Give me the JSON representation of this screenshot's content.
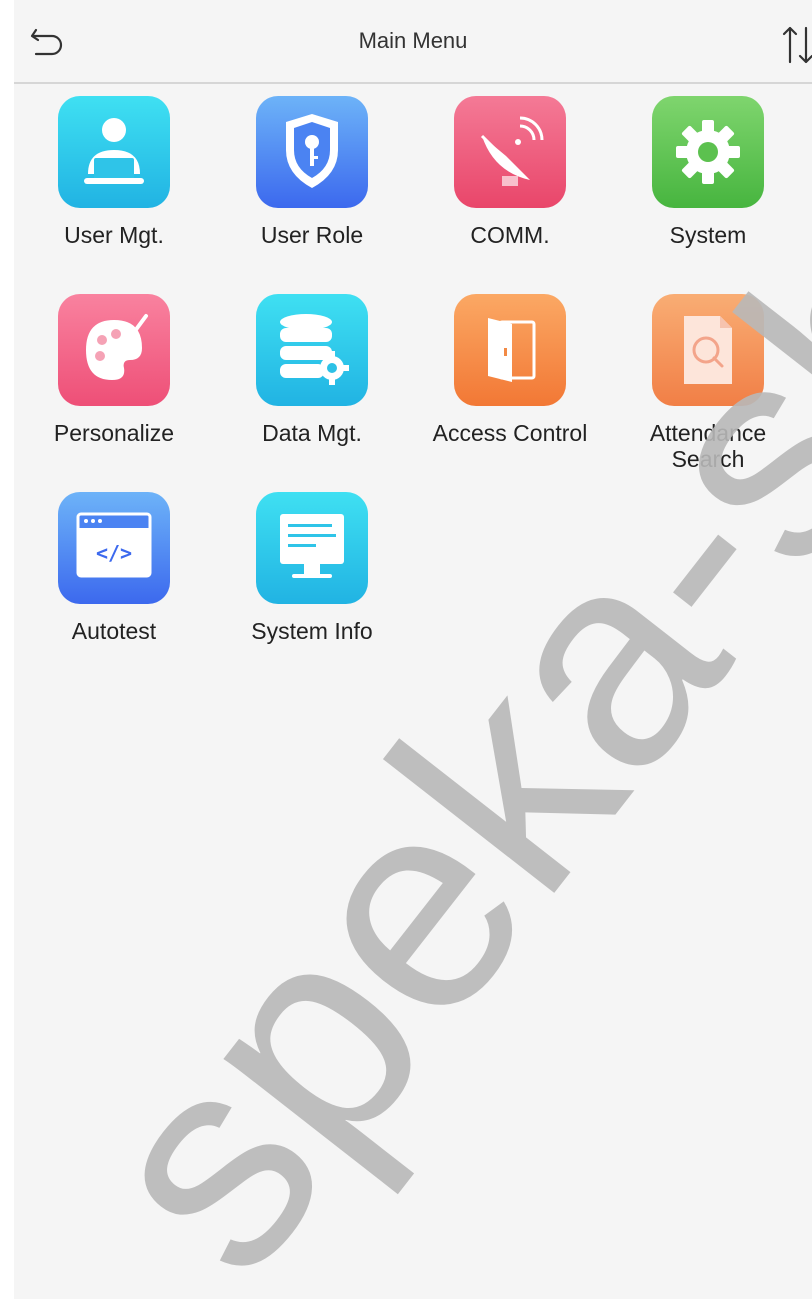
{
  "header": {
    "title": "Main Menu",
    "back_icon": "back-arrow-icon",
    "sort_icon": "sort-arrows-icon"
  },
  "menu": {
    "items": [
      {
        "label": "User Mgt.",
        "icon": "user-icon",
        "color_top": "#3fd6ef",
        "color_bottom": "#1fb6e0"
      },
      {
        "label": "User Role",
        "icon": "shield-key-icon",
        "color_top": "#6aa2f7",
        "color_bottom": "#3d6ef0"
      },
      {
        "label": "COMM.",
        "icon": "satellite-dish-icon",
        "color_top": "#f2708e",
        "color_bottom": "#ec4c6b"
      },
      {
        "label": "System",
        "icon": "gear-icon",
        "color_top": "#79d069",
        "color_bottom": "#4fbb45"
      },
      {
        "label": "Personalize",
        "icon": "palette-icon",
        "color_top": "#f87797",
        "color_bottom": "#ef5278"
      },
      {
        "label": "Data Mgt.",
        "icon": "database-gear-icon",
        "color_top": "#3fd6ef",
        "color_bottom": "#1fb6e0"
      },
      {
        "label": "Access Control",
        "icon": "door-icon",
        "color_top": "#f9a35b",
        "color_bottom": "#f47c3a"
      },
      {
        "label": "Attendance\nSearch",
        "icon": "document-search-icon",
        "color_top": "#f8a76d",
        "color_bottom": "#f3834a"
      },
      {
        "label": "Autotest",
        "icon": "code-window-icon",
        "color_top": "#6aa2f7",
        "color_bottom": "#3d6ef0"
      },
      {
        "label": "System Info",
        "icon": "monitor-icon",
        "color_top": "#3fd6ef",
        "color_bottom": "#1fb6e0"
      }
    ]
  },
  "watermark": {
    "text": "speka-sho"
  }
}
